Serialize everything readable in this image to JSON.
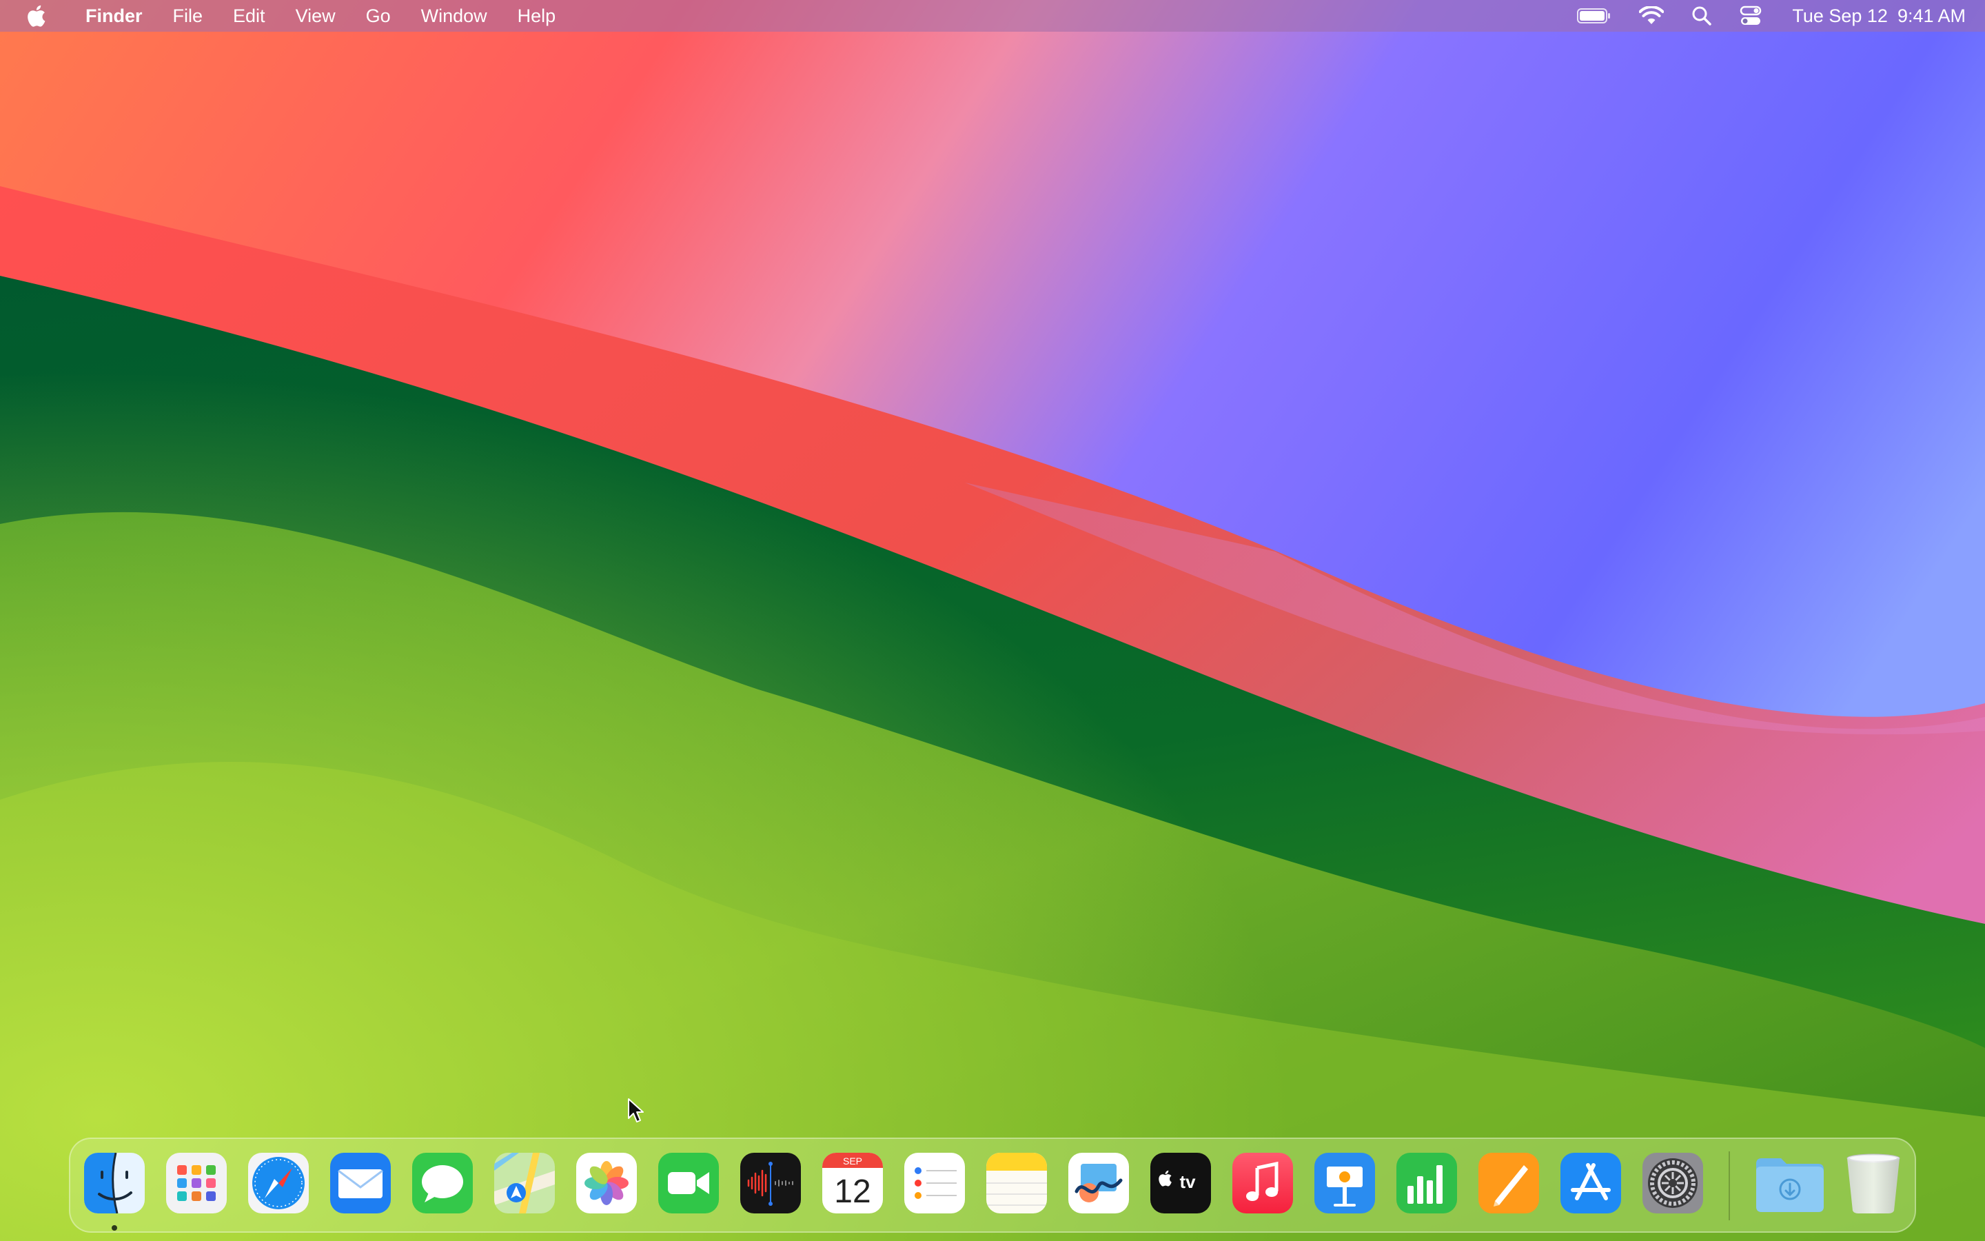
{
  "menubar": {
    "apple_icon": "apple-logo-icon",
    "app_name": "Finder",
    "menus": [
      "File",
      "Edit",
      "View",
      "Go",
      "Window",
      "Help"
    ],
    "status_icons": [
      "battery-icon",
      "wifi-icon",
      "spotlight-search-icon",
      "control-center-icon"
    ],
    "clock": {
      "date": "Tue Sep 12",
      "time": "9:41 AM"
    }
  },
  "dock": {
    "apps": [
      {
        "name": "Finder",
        "icon": "finder-icon",
        "running": true
      },
      {
        "name": "Launchpad",
        "icon": "launchpad-icon"
      },
      {
        "name": "Safari",
        "icon": "safari-icon"
      },
      {
        "name": "Mail",
        "icon": "mail-icon"
      },
      {
        "name": "Messages",
        "icon": "messages-icon"
      },
      {
        "name": "Maps",
        "icon": "maps-icon"
      },
      {
        "name": "Photos",
        "icon": "photos-icon"
      },
      {
        "name": "FaceTime",
        "icon": "facetime-icon"
      },
      {
        "name": "Voice Memos",
        "icon": "voice-memos-icon"
      },
      {
        "name": "Calendar",
        "icon": "calendar-icon",
        "month": "SEP",
        "day": "12"
      },
      {
        "name": "Reminders",
        "icon": "reminders-icon"
      },
      {
        "name": "Notes",
        "icon": "notes-icon"
      },
      {
        "name": "Freeform",
        "icon": "freeform-icon"
      },
      {
        "name": "TV",
        "icon": "apple-tv-icon",
        "label": "tv"
      },
      {
        "name": "Music",
        "icon": "music-icon"
      },
      {
        "name": "Keynote",
        "icon": "keynote-icon"
      },
      {
        "name": "Numbers",
        "icon": "numbers-icon"
      },
      {
        "name": "Pages",
        "icon": "pages-icon"
      },
      {
        "name": "App Store",
        "icon": "app-store-icon"
      },
      {
        "name": "System Settings",
        "icon": "system-settings-icon"
      }
    ],
    "stacks": [
      {
        "name": "Downloads",
        "icon": "downloads-folder-icon"
      },
      {
        "name": "Trash",
        "icon": "trash-icon"
      }
    ]
  }
}
